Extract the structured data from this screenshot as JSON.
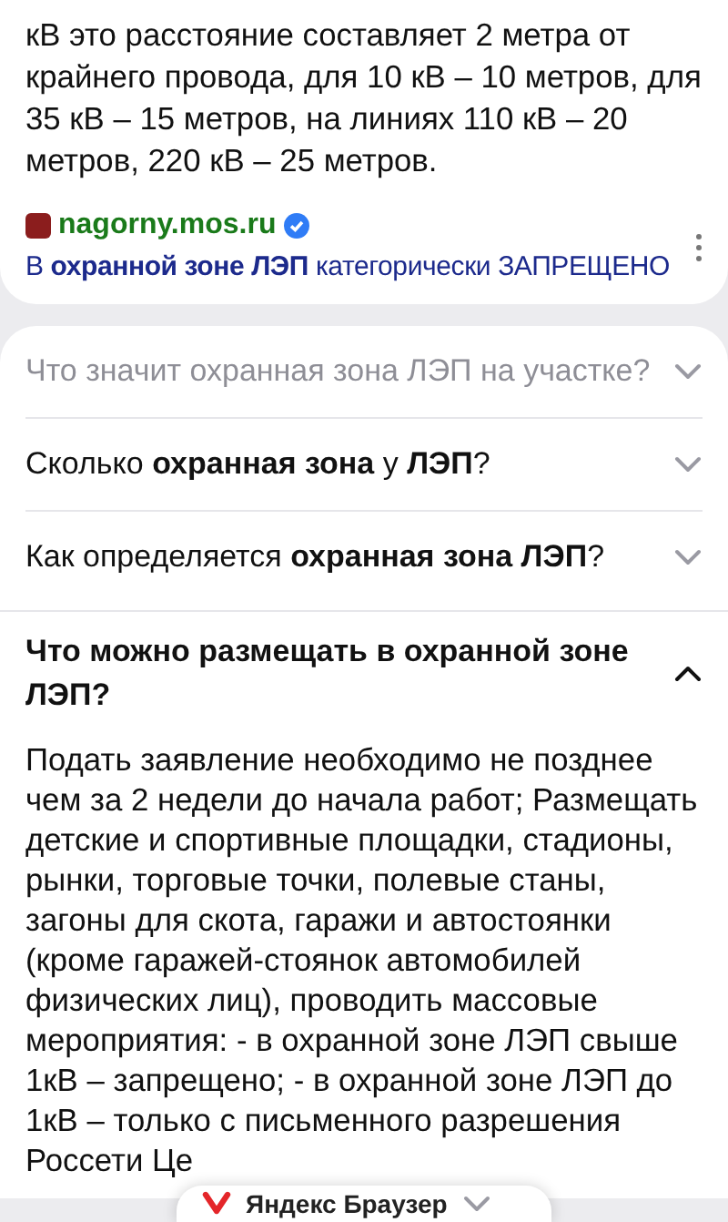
{
  "answer": {
    "lines": [
      "кВ это расстояние составляет 2 метра от крайнего провода, для 10 кВ – 10 метров, для 35 кВ – 15 метров, на линиях 110 кВ – 20 метров, 220 кВ – 25 метров."
    ],
    "source": {
      "domain": "nagorny.mos.ru",
      "verified": true,
      "snippet": "В **охранной зоне ЛЭП** категорически ЗАПРЕЩЕНО"
    }
  },
  "questions": [
    {
      "question": "Что значит охранная зона ЛЭП на участке?",
      "dimmed": true,
      "expanded": false
    },
    {
      "question": "Сколько **охранная зона** у **ЛЭП**?",
      "dimmed": false,
      "expanded": false
    },
    {
      "question": "Как определяется **охранная зона ЛЭП**?",
      "dimmed": false,
      "expanded": false
    },
    {
      "question": "Что можно размещать в охранной зоне ЛЭП?",
      "dimmed": false,
      "expanded": true,
      "answer": "Подать заявление необходимо не позднее чем за 2 недели до начала работ; Размещать детские и спортивные площадки, стадионы, рынки, торговые точки, полевые станы, загоны для скота, гаражи и автостоянки (кроме гаражей-стоянок автомобилей физических лиц), проводить массовые мероприятия: - в охранной зоне ЛЭП свыше 1кВ – запрещено; - в охранной зоне ЛЭП до 1кВ – только с письменного разрешения Россети Це"
    }
  ],
  "browser_prompt": {
    "label": "Яндекс Браузер"
  }
}
